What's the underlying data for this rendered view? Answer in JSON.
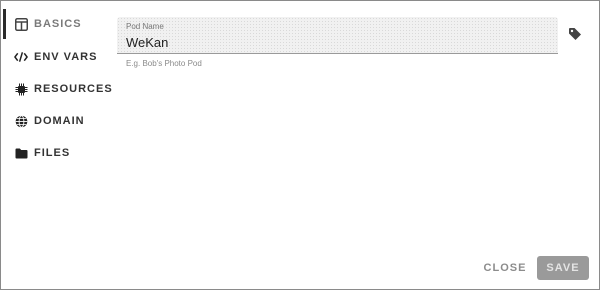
{
  "sidebar": {
    "items": [
      {
        "label": "BASICS",
        "icon": "layout-columns-icon",
        "active": true
      },
      {
        "label": "ENV VARS",
        "icon": "code-icon"
      },
      {
        "label": "RESOURCES",
        "icon": "chip-icon"
      },
      {
        "label": "DOMAIN",
        "icon": "globe-icon"
      },
      {
        "label": "FILES",
        "icon": "folder-icon"
      }
    ]
  },
  "form": {
    "pod_name": {
      "label": "Pod Name",
      "value": "WeKan",
      "helper": "E.g. Bob's Photo Pod"
    },
    "tag_icon": "tag-icon"
  },
  "actions": {
    "close_label": "CLOSE",
    "save_label": "SAVE"
  }
}
